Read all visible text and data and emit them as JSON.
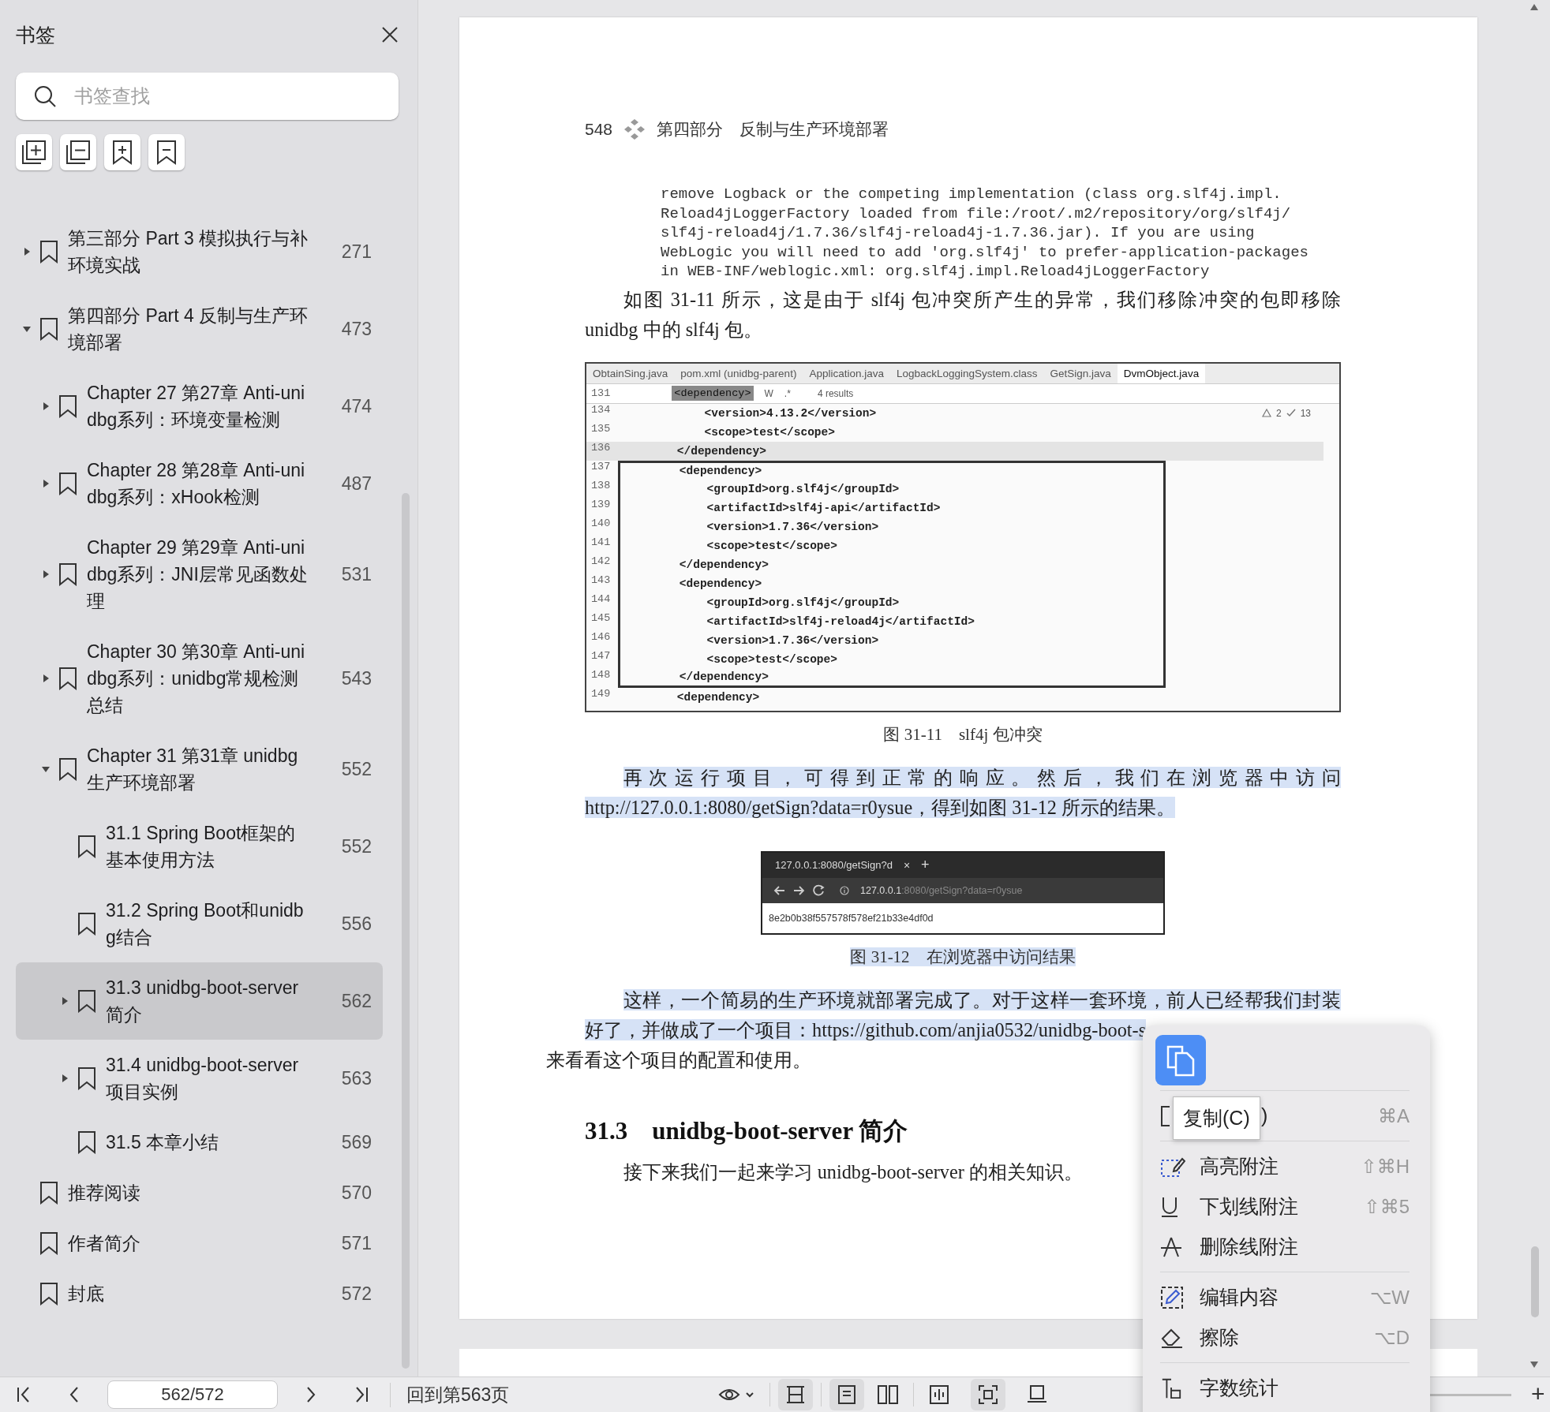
{
  "sidebar": {
    "title": "书签",
    "search": {
      "placeholder": "书签查找"
    },
    "items": [
      {
        "label": "第三部分  Part 3 模拟执行与补环境实战",
        "page": "271",
        "expanded": false,
        "selected": false
      },
      {
        "label": "第四部分  Part 4 反制与生产环境部署",
        "page": "473",
        "expanded": true,
        "selected": false,
        "children": [
          {
            "label": "Chapter 27 第27章 Anti-unidbg系列：环境变量检测",
            "page": "474",
            "expanded": false,
            "selected": false
          },
          {
            "label": "Chapter 28 第28章 Anti-unidbg系列：xHook检测",
            "page": "487",
            "expanded": false,
            "selected": false
          },
          {
            "label": "Chapter 29 第29章 Anti-unidbg系列：JNI层常见函数处理",
            "page": "531",
            "expanded": false,
            "selected": false
          },
          {
            "label": "Chapter 30 第30章 Anti-unidbg系列：unidbg常规检测总结",
            "page": "543",
            "expanded": false,
            "selected": false
          },
          {
            "label": "Chapter 31 第31章 unidbg生产环境部署",
            "page": "552",
            "expanded": true,
            "selected": false,
            "children": [
              {
                "label": "31.1 Spring Boot框架的基本使用方法",
                "page": "552",
                "selected": false
              },
              {
                "label": "31.2 Spring Boot和unidbg结合",
                "page": "556",
                "selected": false
              },
              {
                "label": "31.3 unidbg-boot-server简介",
                "page": "562",
                "expanded": false,
                "selected": true
              },
              {
                "label": "31.4 unidbg-boot-server项目实例",
                "page": "563",
                "expanded": false,
                "selected": false
              },
              {
                "label": "31.5 本章小结",
                "page": "569",
                "selected": false
              }
            ]
          }
        ]
      },
      {
        "label": "推荐阅读",
        "page": "570",
        "selected": false
      },
      {
        "label": "作者简介",
        "page": "571",
        "selected": false
      },
      {
        "label": "封底",
        "page": "572",
        "selected": false
      }
    ]
  },
  "page": {
    "number": "548",
    "part": "第四部分　反制与生产环境部署",
    "log_lines": [
      "remove Logback or the competing implementation (class org.slf4j.impl.",
      "Reload4jLoggerFactory loaded from file:/root/.m2/repository/org/slf4j/",
      "slf4j-reload4j/1.7.36/slf4j-reload4j-1.7.36.jar). If you are using",
      "WebLogic you will need to add 'org.slf4j' to prefer-application-packages",
      "in WEB-INF/weblogic.xml: org.slf4j.impl.Reload4jLoggerFactory"
    ],
    "para1": {
      "text": "如图 31-11 所示，这是由于 slf4j 包冲突所产生的异常，我们移除冲突的包即移除 unidbg 中的 slf4j 包。",
      "highlighted": false
    },
    "ide": {
      "tabs": [
        {
          "label": "ObtainSing.java",
          "selected": false
        },
        {
          "label": "pom.xml (unidbg-parent)",
          "selected": false
        },
        {
          "label": "Application.java",
          "selected": false
        },
        {
          "label": "LogbackLoggingSystem.class",
          "selected": false
        },
        {
          "label": "GetSign.java",
          "selected": false
        },
        {
          "label": "DvmObject.java",
          "selected": true
        }
      ],
      "search_line": "131",
      "search_text": "<dependency>",
      "search_word": "W",
      "search_regex": ".*",
      "results": "4 results",
      "warnings": "2",
      "checks": "13",
      "lines": [
        {
          "n": "134",
          "code": "        <version>4.13.2</version>",
          "current": false,
          "boxed": false
        },
        {
          "n": "135",
          "code": "        <scope>test</scope>",
          "current": false,
          "boxed": false
        },
        {
          "n": "136",
          "code": "    </dependency>",
          "current": true,
          "boxed": false
        },
        {
          "n": "137",
          "code": "    <dependency>",
          "current": false,
          "boxed": true
        },
        {
          "n": "138",
          "code": "        <groupId>org.slf4j</groupId>",
          "current": false,
          "boxed": true
        },
        {
          "n": "139",
          "code": "        <artifactId>slf4j-api</artifactId>",
          "current": false,
          "boxed": true
        },
        {
          "n": "140",
          "code": "        <version>1.7.36</version>",
          "current": false,
          "boxed": true
        },
        {
          "n": "141",
          "code": "        <scope>test</scope>",
          "current": false,
          "boxed": true
        },
        {
          "n": "142",
          "code": "    </dependency>",
          "current": false,
          "boxed": true
        },
        {
          "n": "143",
          "code": "    <dependency>",
          "current": false,
          "boxed": true
        },
        {
          "n": "144",
          "code": "        <groupId>org.slf4j</groupId>",
          "current": false,
          "boxed": true
        },
        {
          "n": "145",
          "code": "        <artifactId>slf4j-reload4j</artifactId>",
          "current": false,
          "boxed": true
        },
        {
          "n": "146",
          "code": "        <version>1.7.36</version>",
          "current": false,
          "boxed": true
        },
        {
          "n": "147",
          "code": "        <scope>test</scope>",
          "current": false,
          "boxed": true
        },
        {
          "n": "148",
          "code": "    </dependency>",
          "current": false,
          "boxed": true
        },
        {
          "n": "149",
          "code": "    <dependency>",
          "current": false,
          "boxed": false
        }
      ]
    },
    "caption1": {
      "text": "图 31-11　slf4j 包冲突",
      "highlighted": false
    },
    "para2": {
      "text": "再次运行项目，可得到正常的响应。然后，我们在浏览器中访问 http://127.0.0.1:8080/getSign?data=r0ysue，得到如图 31-12 所示的结果。",
      "highlighted": true
    },
    "browser": {
      "tab": "127.0.0.1:8080/getSign?d",
      "tab_close": "×",
      "new_tab": "+",
      "url_host": "127.0.0.1",
      "url_rest": ":8080/getSign?data=r0ysue",
      "body": "8e2b0b38f557578f578ef21b33e4df0d"
    },
    "caption2": {
      "text": "图 31-12　在浏览器中访问结果",
      "highlighted": true
    },
    "para3": {
      "text": "这样，一个简易的生产环境就部署完成了。对于这样一套环境，前人已经帮我们封装好了，并做成了一个项目：https://github.com/anjia0532/unidbg-boot-s",
      "highlighted": true,
      "after": "来看看这个项目的配置和使用。"
    },
    "heading": "31.3　unidbg-boot-server 简介",
    "para4": {
      "text": "接下来我们一起来学习 unidbg-boot-server 的相关知识。",
      "highlighted": false
    }
  },
  "menu": {
    "tooltip": "复制(C)",
    "items": [
      {
        "kind": "select",
        "label": ")",
        "shortcut": "⌘A"
      },
      {
        "kind": "divider"
      },
      {
        "kind": "highlight",
        "label": "高亮附注",
        "shortcut": "⇧⌘H"
      },
      {
        "kind": "underline",
        "label": "下划线附注",
        "shortcut": "⇧⌘5"
      },
      {
        "kind": "strike",
        "label": "删除线附注"
      },
      {
        "kind": "divider"
      },
      {
        "kind": "edit",
        "label": "编辑内容",
        "shortcut": "⌥W"
      },
      {
        "kind": "erase",
        "label": "擦除",
        "shortcut": "⌥D"
      },
      {
        "kind": "divider"
      },
      {
        "kind": "count",
        "label": "字数统计"
      }
    ]
  },
  "bottom_bar": {
    "page_field": "562/572",
    "back_link": "回到第563页",
    "zoom_plus": "+"
  }
}
